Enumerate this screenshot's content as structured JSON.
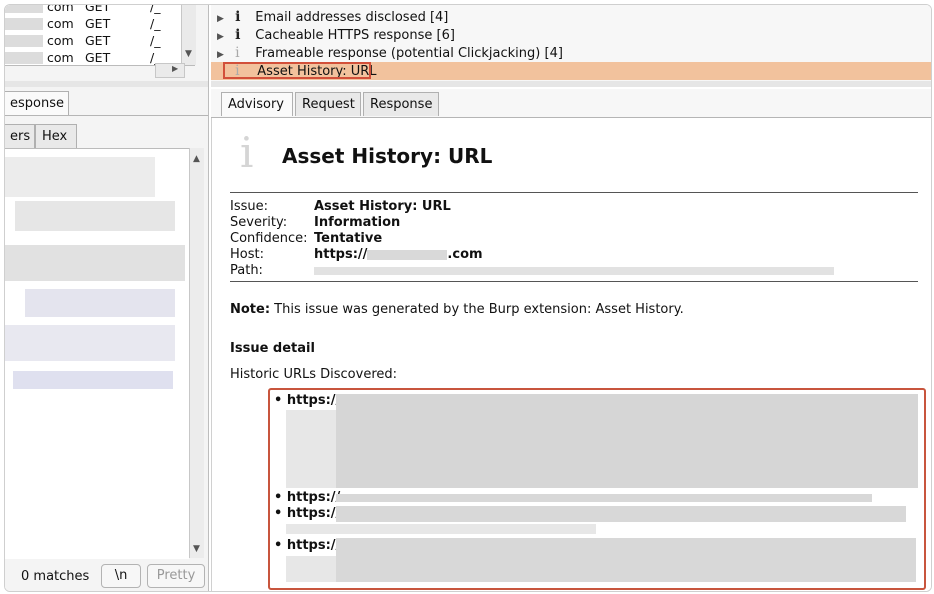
{
  "left_pane": {
    "request_rows": [
      {
        "host": "com",
        "method": "GET",
        "path": "/_"
      },
      {
        "host": "com",
        "method": "GET",
        "path": "/_"
      },
      {
        "host": "com",
        "method": "GET",
        "path": "/_"
      },
      {
        "host": "com",
        "method": "GET",
        "path": "/_"
      }
    ],
    "tabs": {
      "response": "esponse"
    },
    "subtabs": {
      "headers": "ers",
      "hex": "Hex"
    },
    "search": {
      "matches": "0 matches",
      "newline_button": "\\n",
      "pretty_button": "Pretty"
    }
  },
  "issues": [
    {
      "icon": "i",
      "label": "Email addresses disclosed [4]"
    },
    {
      "icon": "i",
      "label": "Cacheable HTTPS response [6]"
    },
    {
      "icon": "i",
      "label": "Frameable response (potential Clickjacking) [4]"
    },
    {
      "icon": "i",
      "label": "Asset History: URL",
      "selected": true
    }
  ],
  "detail_tabs": {
    "advisory": "Advisory",
    "request": "Request",
    "response": "Response"
  },
  "advisory": {
    "icon": "i",
    "title": "Asset History: URL",
    "fields": {
      "issue_label": "Issue:",
      "issue_value": "Asset History: URL",
      "severity_label": "Severity:",
      "severity_value": "Information",
      "confidence_label": "Confidence:",
      "confidence_value": "Tentative",
      "host_label": "Host:",
      "host_prefix": "https://",
      "host_suffix": ".com",
      "path_label": "Path:"
    },
    "note_label": "Note:",
    "note_text": " This issue was generated by the Burp extension: Asset History.",
    "issue_detail_heading": "Issue detail",
    "historic_label": "Historic URLs Discovered:",
    "url_prefix": "https://"
  },
  "colors": {
    "selection": "#f2c29d",
    "highlight_outline": "#d2503a",
    "url_box_outline": "#c8553d"
  }
}
